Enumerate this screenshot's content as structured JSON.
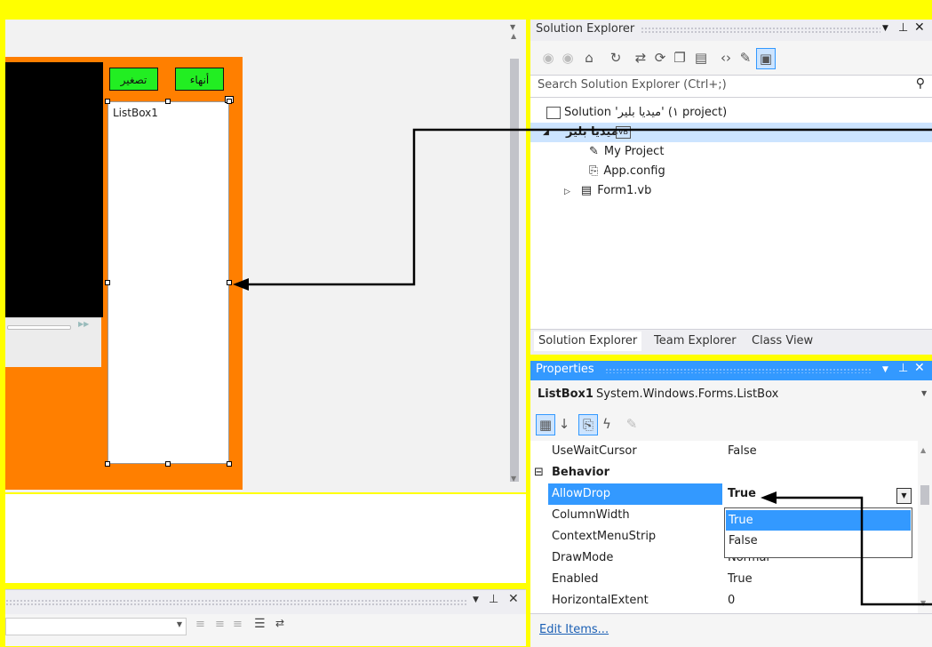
{
  "designer": {
    "buttons": {
      "exit_label": "أنهاء",
      "shrink_label": "تصغير"
    },
    "listbox_label": "ListBox1"
  },
  "solution_explorer": {
    "title": "Solution Explorer",
    "search_placeholder": "Search Solution Explorer (Ctrl+;)",
    "tree": {
      "solution": "Solution 'ميديا بلير' (١ project)",
      "project": "ميديا بلير",
      "items": [
        "My Project",
        "App.config",
        "Form1.vb"
      ]
    },
    "tabs": [
      "Solution Explorer",
      "Team Explorer",
      "Class View"
    ]
  },
  "properties": {
    "title": "Properties",
    "object_name": "ListBox1",
    "object_type": "System.Windows.Forms.ListBox",
    "category": "Behavior",
    "rows": [
      {
        "name": "UseWaitCursor",
        "value": "False"
      },
      {
        "name": "AllowDrop",
        "value": "True"
      },
      {
        "name": "ColumnWidth",
        "value": ""
      },
      {
        "name": "ContextMenuStrip",
        "value": ""
      },
      {
        "name": "DrawMode",
        "value": "Normal"
      },
      {
        "name": "Enabled",
        "value": "True"
      },
      {
        "name": "HorizontalExtent",
        "value": "0"
      }
    ],
    "dropdown_options": [
      "True",
      "False"
    ],
    "edit_items_link": "Edit Items..."
  },
  "colors": {
    "form_background": "#FF7F00",
    "button_green": "#22EE22",
    "selection_blue": "#3399FF",
    "page_background": "#FFFF00"
  }
}
